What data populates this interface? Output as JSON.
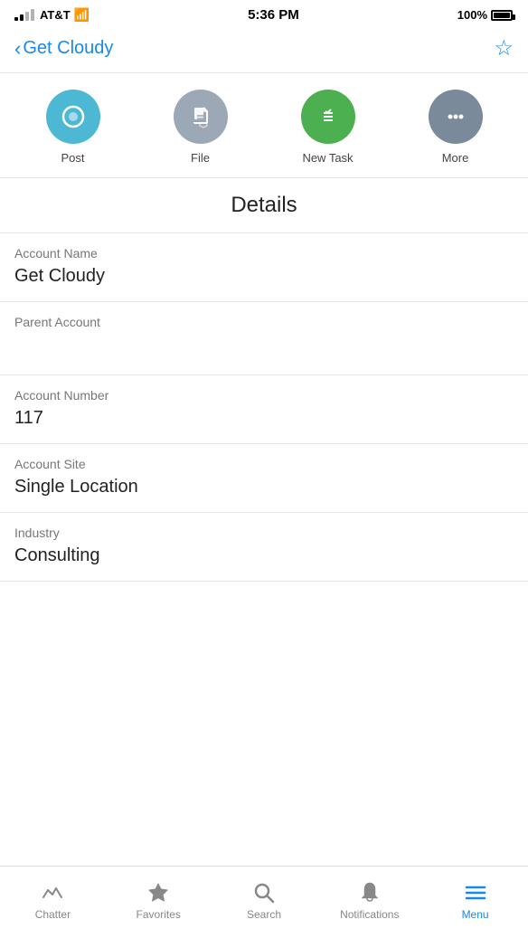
{
  "statusBar": {
    "carrier": "AT&T",
    "time": "5:36 PM",
    "battery": "100%"
  },
  "header": {
    "backLabel": "Get Cloudy",
    "bookmarkLabel": "☆"
  },
  "actions": [
    {
      "id": "post",
      "label": "Post",
      "colorClass": "post"
    },
    {
      "id": "file",
      "label": "File",
      "colorClass": "file"
    },
    {
      "id": "task",
      "label": "New Task",
      "colorClass": "task"
    },
    {
      "id": "more",
      "label": "More",
      "colorClass": "more"
    }
  ],
  "detailsHeader": "Details",
  "fields": [
    {
      "label": "Account Name",
      "value": "Get Cloudy"
    },
    {
      "label": "Parent Account",
      "value": ""
    },
    {
      "label": "Account Number",
      "value": "117"
    },
    {
      "label": "Account Site",
      "value": "Single Location"
    },
    {
      "label": "Industry",
      "value": "Consulting"
    }
  ],
  "tabBar": [
    {
      "id": "chatter",
      "label": "Chatter",
      "active": false
    },
    {
      "id": "favorites",
      "label": "Favorites",
      "active": false
    },
    {
      "id": "search",
      "label": "Search",
      "active": false
    },
    {
      "id": "notifications",
      "label": "Notifications",
      "active": false
    },
    {
      "id": "menu",
      "label": "Menu",
      "active": true
    }
  ]
}
